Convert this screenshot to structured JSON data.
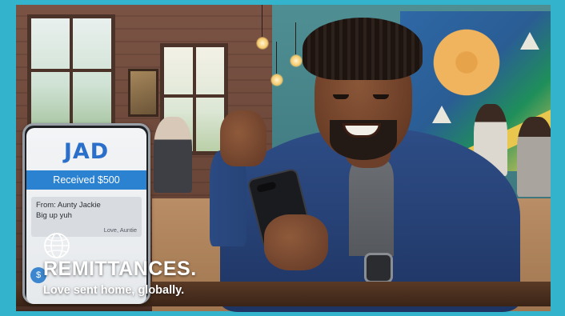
{
  "phone_app": {
    "brand": "JAD",
    "received_label": "Received $500",
    "message": {
      "from": "From: Aunty Jackie",
      "body": "Big up yuh",
      "sign_off": "Love, Auntie"
    },
    "badge_symbol": "$"
  },
  "ad": {
    "headline": "REMITTANCES.",
    "tagline": "Love sent home, globally."
  },
  "icons": {
    "globe": "globe-icon"
  },
  "colors": {
    "frame_border": "#33b4cc",
    "brand_blue": "#2a6fc9",
    "received_bar": "#2b82d0"
  }
}
